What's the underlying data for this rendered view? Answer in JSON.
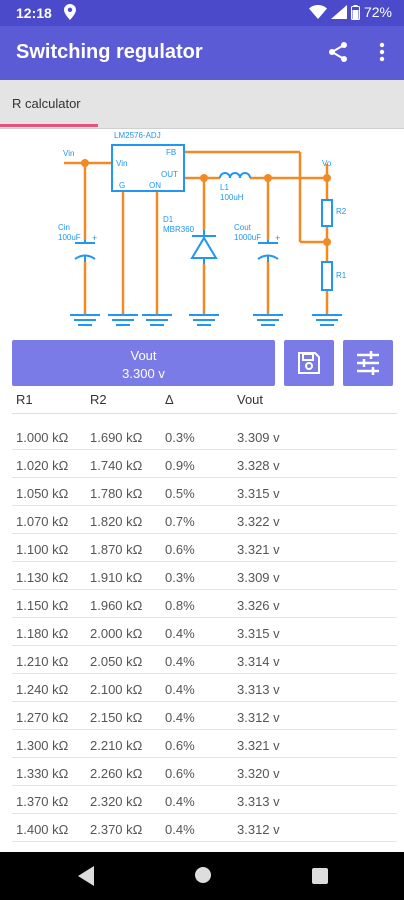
{
  "status": {
    "time": "12:18",
    "battery": "72%",
    "location_icon": "location-icon",
    "wifi_icon": "wifi-icon",
    "signal_icon": "signal-icon",
    "battery_icon": "battery-icon"
  },
  "app_bar": {
    "title": "Switching regulator",
    "share_icon": "share-icon",
    "more_icon": "more-vert-icon",
    "color": "#5b5bd6"
  },
  "tabs": [
    {
      "label": "R calculator",
      "active": true
    }
  ],
  "schematic": {
    "chip": "LM2576-ADJ",
    "vin_label": "Vin",
    "vin_pin": "Vin",
    "fb_pin": "FB",
    "out_pin": "OUT",
    "g_pin": "G",
    "on_pin": "ON",
    "vo_label": "Vo",
    "l1_name": "L1",
    "l1_value": "100uH",
    "d1_name": "D1",
    "d1_part": "MBR360",
    "cin_name": "Cin",
    "cin_value": "100uF",
    "cout_name": "Cout",
    "cout_value": "1000uF",
    "r1": "R1",
    "r2": "R2",
    "wire_color": "#f08a24",
    "component_color": "#2196f3"
  },
  "vout_button": {
    "title": "Vout",
    "value": "3.300 v"
  },
  "toolbar": {
    "save_icon": "save-icon",
    "tune_icon": "tune-icon"
  },
  "results": {
    "headers": [
      "R1",
      "R2",
      "Δ",
      "Vout"
    ],
    "rows": [
      [
        "1.000 kΩ",
        "1.690 kΩ",
        "0.3%",
        "3.309 v"
      ],
      [
        "1.020 kΩ",
        "1.740 kΩ",
        "0.9%",
        "3.328 v"
      ],
      [
        "1.050 kΩ",
        "1.780 kΩ",
        "0.5%",
        "3.315 v"
      ],
      [
        "1.070 kΩ",
        "1.820 kΩ",
        "0.7%",
        "3.322 v"
      ],
      [
        "1.100 kΩ",
        "1.870 kΩ",
        "0.6%",
        "3.321 v"
      ],
      [
        "1.130 kΩ",
        "1.910 kΩ",
        "0.3%",
        "3.309 v"
      ],
      [
        "1.150 kΩ",
        "1.960 kΩ",
        "0.8%",
        "3.326 v"
      ],
      [
        "1.180 kΩ",
        "2.000 kΩ",
        "0.4%",
        "3.315 v"
      ],
      [
        "1.210 kΩ",
        "2.050 kΩ",
        "0.4%",
        "3.314 v"
      ],
      [
        "1.240 kΩ",
        "2.100 kΩ",
        "0.4%",
        "3.313 v"
      ],
      [
        "1.270 kΩ",
        "2.150 kΩ",
        "0.4%",
        "3.312 v"
      ],
      [
        "1.300 kΩ",
        "2.210 kΩ",
        "0.6%",
        "3.321 v"
      ],
      [
        "1.330 kΩ",
        "2.260 kΩ",
        "0.6%",
        "3.320 v"
      ],
      [
        "1.370 kΩ",
        "2.320 kΩ",
        "0.4%",
        "3.313 v"
      ],
      [
        "1.400 kΩ",
        "2.370 kΩ",
        "0.4%",
        "3.312 v"
      ]
    ]
  },
  "nav": {
    "back_icon": "back-icon",
    "home_icon": "home-icon",
    "recents_icon": "recents-icon"
  }
}
